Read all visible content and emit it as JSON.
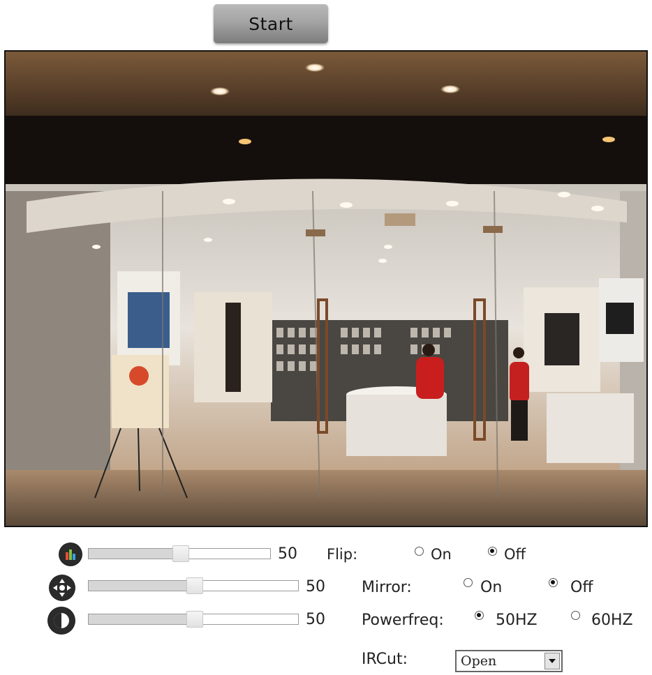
{
  "toolbar": {
    "start_label": "Start"
  },
  "camera": {
    "feed": "camera-feed"
  },
  "sliders": [
    {
      "icon": "brightness-icon",
      "value": "50",
      "level": 50
    },
    {
      "icon": "move-icon",
      "value": "50",
      "level": 50
    },
    {
      "icon": "contrast-icon",
      "value": "50",
      "level": 50
    }
  ],
  "flip": {
    "label": "Flip:",
    "options": [
      "On",
      "Off"
    ],
    "selected": "Off"
  },
  "mirror": {
    "label": "Mirror:",
    "options": [
      "On",
      "Off"
    ],
    "selected": "Off"
  },
  "powerfreq": {
    "label": "Powerfreq:",
    "options": [
      "50HZ",
      "60HZ"
    ],
    "selected": "50HZ"
  },
  "ircut": {
    "label": "IRCut:",
    "value": "Open"
  },
  "colors": {
    "button_gray": "#a4a4a4",
    "slider_fill": "#d6d6d6"
  }
}
